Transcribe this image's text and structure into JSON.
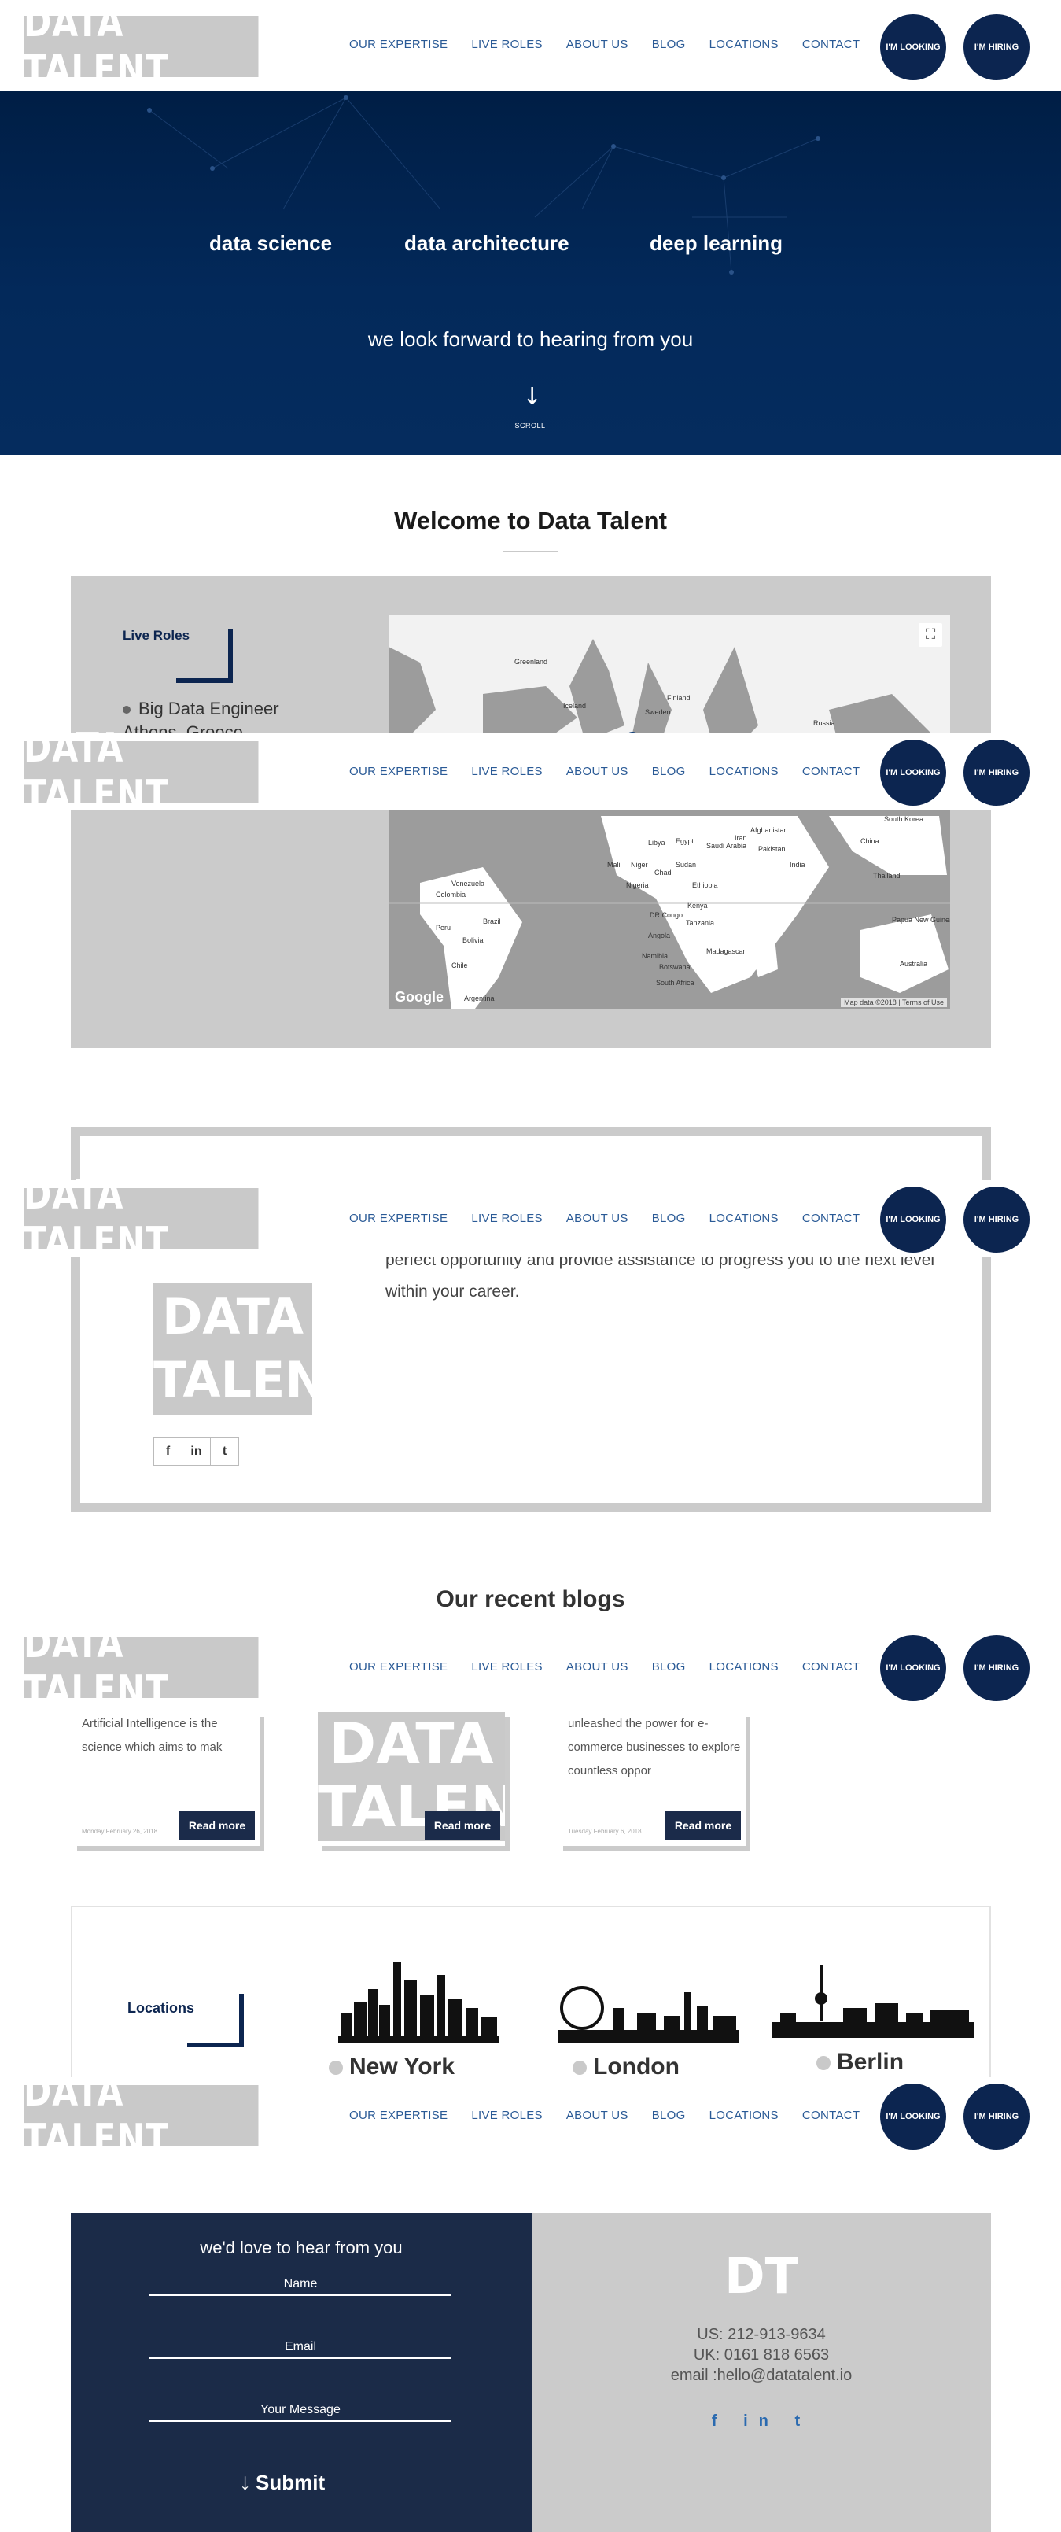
{
  "header": {
    "logo": "DATA TALENT",
    "nav": [
      "OUR EXPERTISE",
      "LIVE ROLES",
      "ABOUT US",
      "BLOG",
      "LOCATIONS",
      "CONTACT"
    ],
    "cta_looking": "I'M LOOKING",
    "cta_hiring": "I'M HIRING"
  },
  "hero": {
    "topics": [
      "data science",
      "data architecture",
      "deep learning"
    ],
    "tagline": "we look forward to hearing from you",
    "scroll": "SCROLL"
  },
  "welcome": {
    "title": "Welcome to Data Talent"
  },
  "live_roles": {
    "label": "Live Roles",
    "items": [
      {
        "title": "Big Data Engineer",
        "location": "Athens, Greece"
      }
    ],
    "map": {
      "google": "Google",
      "attribution": "Map data ©2018 | Terms of Use",
      "fullscreen_icon": "fullscreen-icon",
      "places": [
        "Greenland",
        "Iceland",
        "Sweden",
        "Finland",
        "Russia",
        "China",
        "India",
        "Pakistan",
        "Iran",
        "Afghanistan",
        "Libya",
        "Egypt",
        "Mali",
        "Niger",
        "Chad",
        "Sudan",
        "Nigeria",
        "Ethiopia",
        "Kenya",
        "Tanzania",
        "Angola",
        "Namibia",
        "Botswana",
        "South Africa",
        "Madagascar",
        "DR Congo",
        "Saudi Arabia",
        "Venezuela",
        "Colombia",
        "Peru",
        "Brazil",
        "Bolivia",
        "Chile",
        "Argentina",
        "Thailand",
        "Australia",
        "Papua New Guinea",
        "South Korea"
      ]
    }
  },
  "about": {
    "text": "perfect opportunity and provide assistance to progress you to the next level within your career.",
    "logo_line1": "DATA",
    "logo_line2": "TALENT",
    "social": [
      "f",
      "in",
      "t"
    ]
  },
  "blogs": {
    "title": "Our recent blogs",
    "cards": [
      {
        "excerpt": "Artificial Intelligence is the science which aims to mak",
        "date": "Monday February 26, 2018",
        "read_more": "Read more"
      },
      {
        "excerpt": "",
        "date": "",
        "read_more": "Read more",
        "image_text": "DATA TALENT"
      },
      {
        "excerpt": "unleashed the power for e-commerce businesses to explore countless oppor",
        "date": "Tuesday February 6, 2018",
        "read_more": "Read more"
      }
    ]
  },
  "locations": {
    "label": "Locations",
    "cities": [
      "New York",
      "London",
      "Berlin"
    ]
  },
  "contact": {
    "title": "we'd love to hear from you",
    "name_placeholder": "Name",
    "email_placeholder": "Email",
    "message_placeholder": "Your Message",
    "submit": "Submit",
    "dt": "DT",
    "us_phone": "US: 212-913-9634",
    "uk_phone": "UK: 0161 818 6563",
    "email": "email :hello@datatalent.io",
    "social": [
      "f",
      "in",
      "t"
    ]
  },
  "colors": {
    "navy": "#0c2550",
    "grey": "#c9c9c9",
    "link": "#2a5a96",
    "dark": "#1b2b48"
  }
}
